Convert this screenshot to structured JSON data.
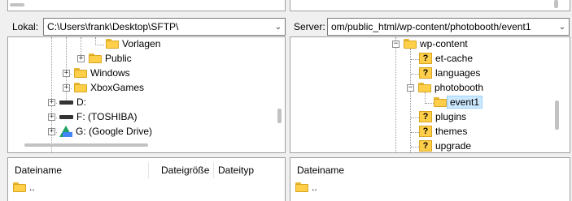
{
  "local": {
    "label": "Lokal:",
    "path": "C:\\Users\\frank\\Desktop\\SFTP\\",
    "tree": [
      {
        "label": "Vorlagen",
        "icon": "folder"
      },
      {
        "label": "Public",
        "icon": "folder"
      },
      {
        "label": "Windows",
        "icon": "folder"
      },
      {
        "label": "XboxGames",
        "icon": "folder"
      },
      {
        "label": "D:",
        "icon": "drive"
      },
      {
        "label": "F: (TOSHIBA)",
        "icon": "drive"
      },
      {
        "label": "G: (Google Drive)",
        "icon": "google-drive"
      }
    ],
    "list": {
      "columns": [
        "Dateiname",
        "Dateigröße",
        "Dateityp"
      ],
      "sort_indicator": "^",
      "rows": [
        {
          "name": ".."
        }
      ]
    }
  },
  "remote": {
    "label": "Server:",
    "path": "om/public_html/wp-content/photobooth/event1",
    "tree": [
      {
        "label": "wp-content",
        "icon": "folder"
      },
      {
        "label": "et-cache",
        "icon": "unknown-folder"
      },
      {
        "label": "languages",
        "icon": "unknown-folder"
      },
      {
        "label": "photobooth",
        "icon": "folder"
      },
      {
        "label": "event1",
        "icon": "folder",
        "selected": true
      },
      {
        "label": "plugins",
        "icon": "unknown-folder"
      },
      {
        "label": "themes",
        "icon": "unknown-folder"
      },
      {
        "label": "upgrade",
        "icon": "unknown-folder"
      }
    ],
    "list": {
      "columns": [
        "Dateiname"
      ],
      "rows": [
        {
          "name": ".."
        }
      ]
    }
  },
  "icons": {
    "expand": "+",
    "collapse": "−",
    "dropdown": "⌄",
    "unknown_folder_mark": "?"
  }
}
